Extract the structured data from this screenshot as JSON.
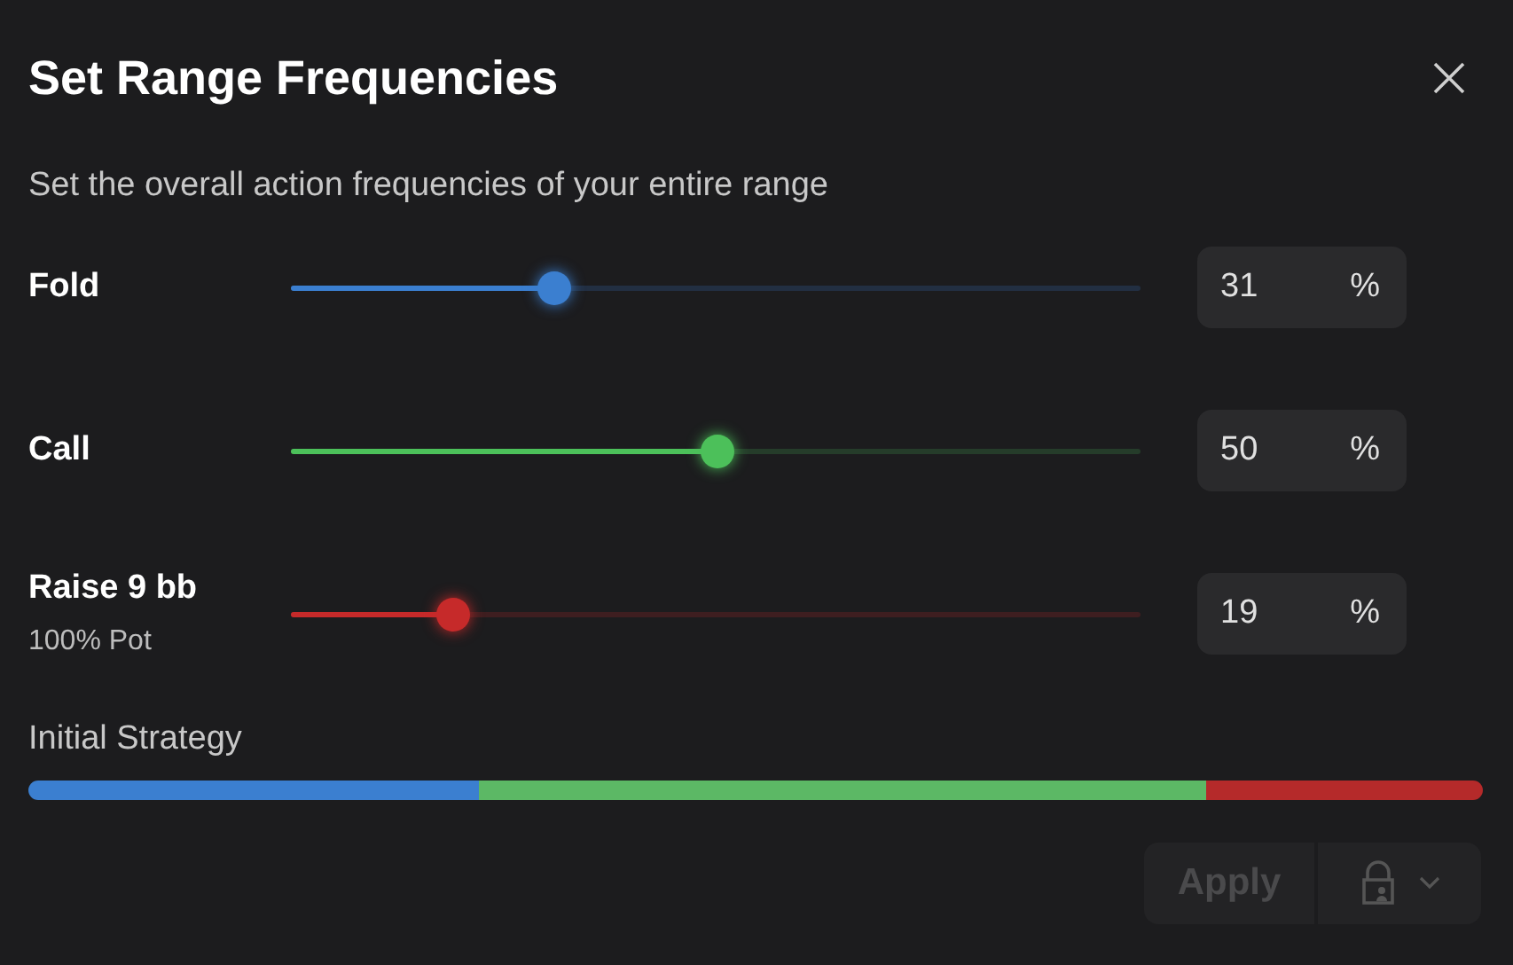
{
  "dialog": {
    "title": "Set Range Frequencies",
    "description": "Set the overall action frequencies of your entire range"
  },
  "actions": [
    {
      "label": "Fold",
      "level": 0.31,
      "value": "31",
      "unit": "%",
      "color": "#3b7fd0"
    },
    {
      "label": "Call",
      "level": 0.5,
      "value": "50",
      "unit": "%",
      "color": "#4cc05a"
    },
    {
      "label": "Raise 9 bb",
      "sublabel": "100% Pot",
      "level": 0.19,
      "value": "19",
      "unit": "%",
      "color": "#c62a2a"
    }
  ],
  "initial_strategy": {
    "label": "Initial Strategy",
    "segments": [
      {
        "color": "#3b7fd0"
      },
      {
        "color": "#5cb865"
      },
      {
        "color": "#b52a2a"
      }
    ]
  },
  "apply_button": {
    "label": "Apply",
    "disabled": true
  }
}
